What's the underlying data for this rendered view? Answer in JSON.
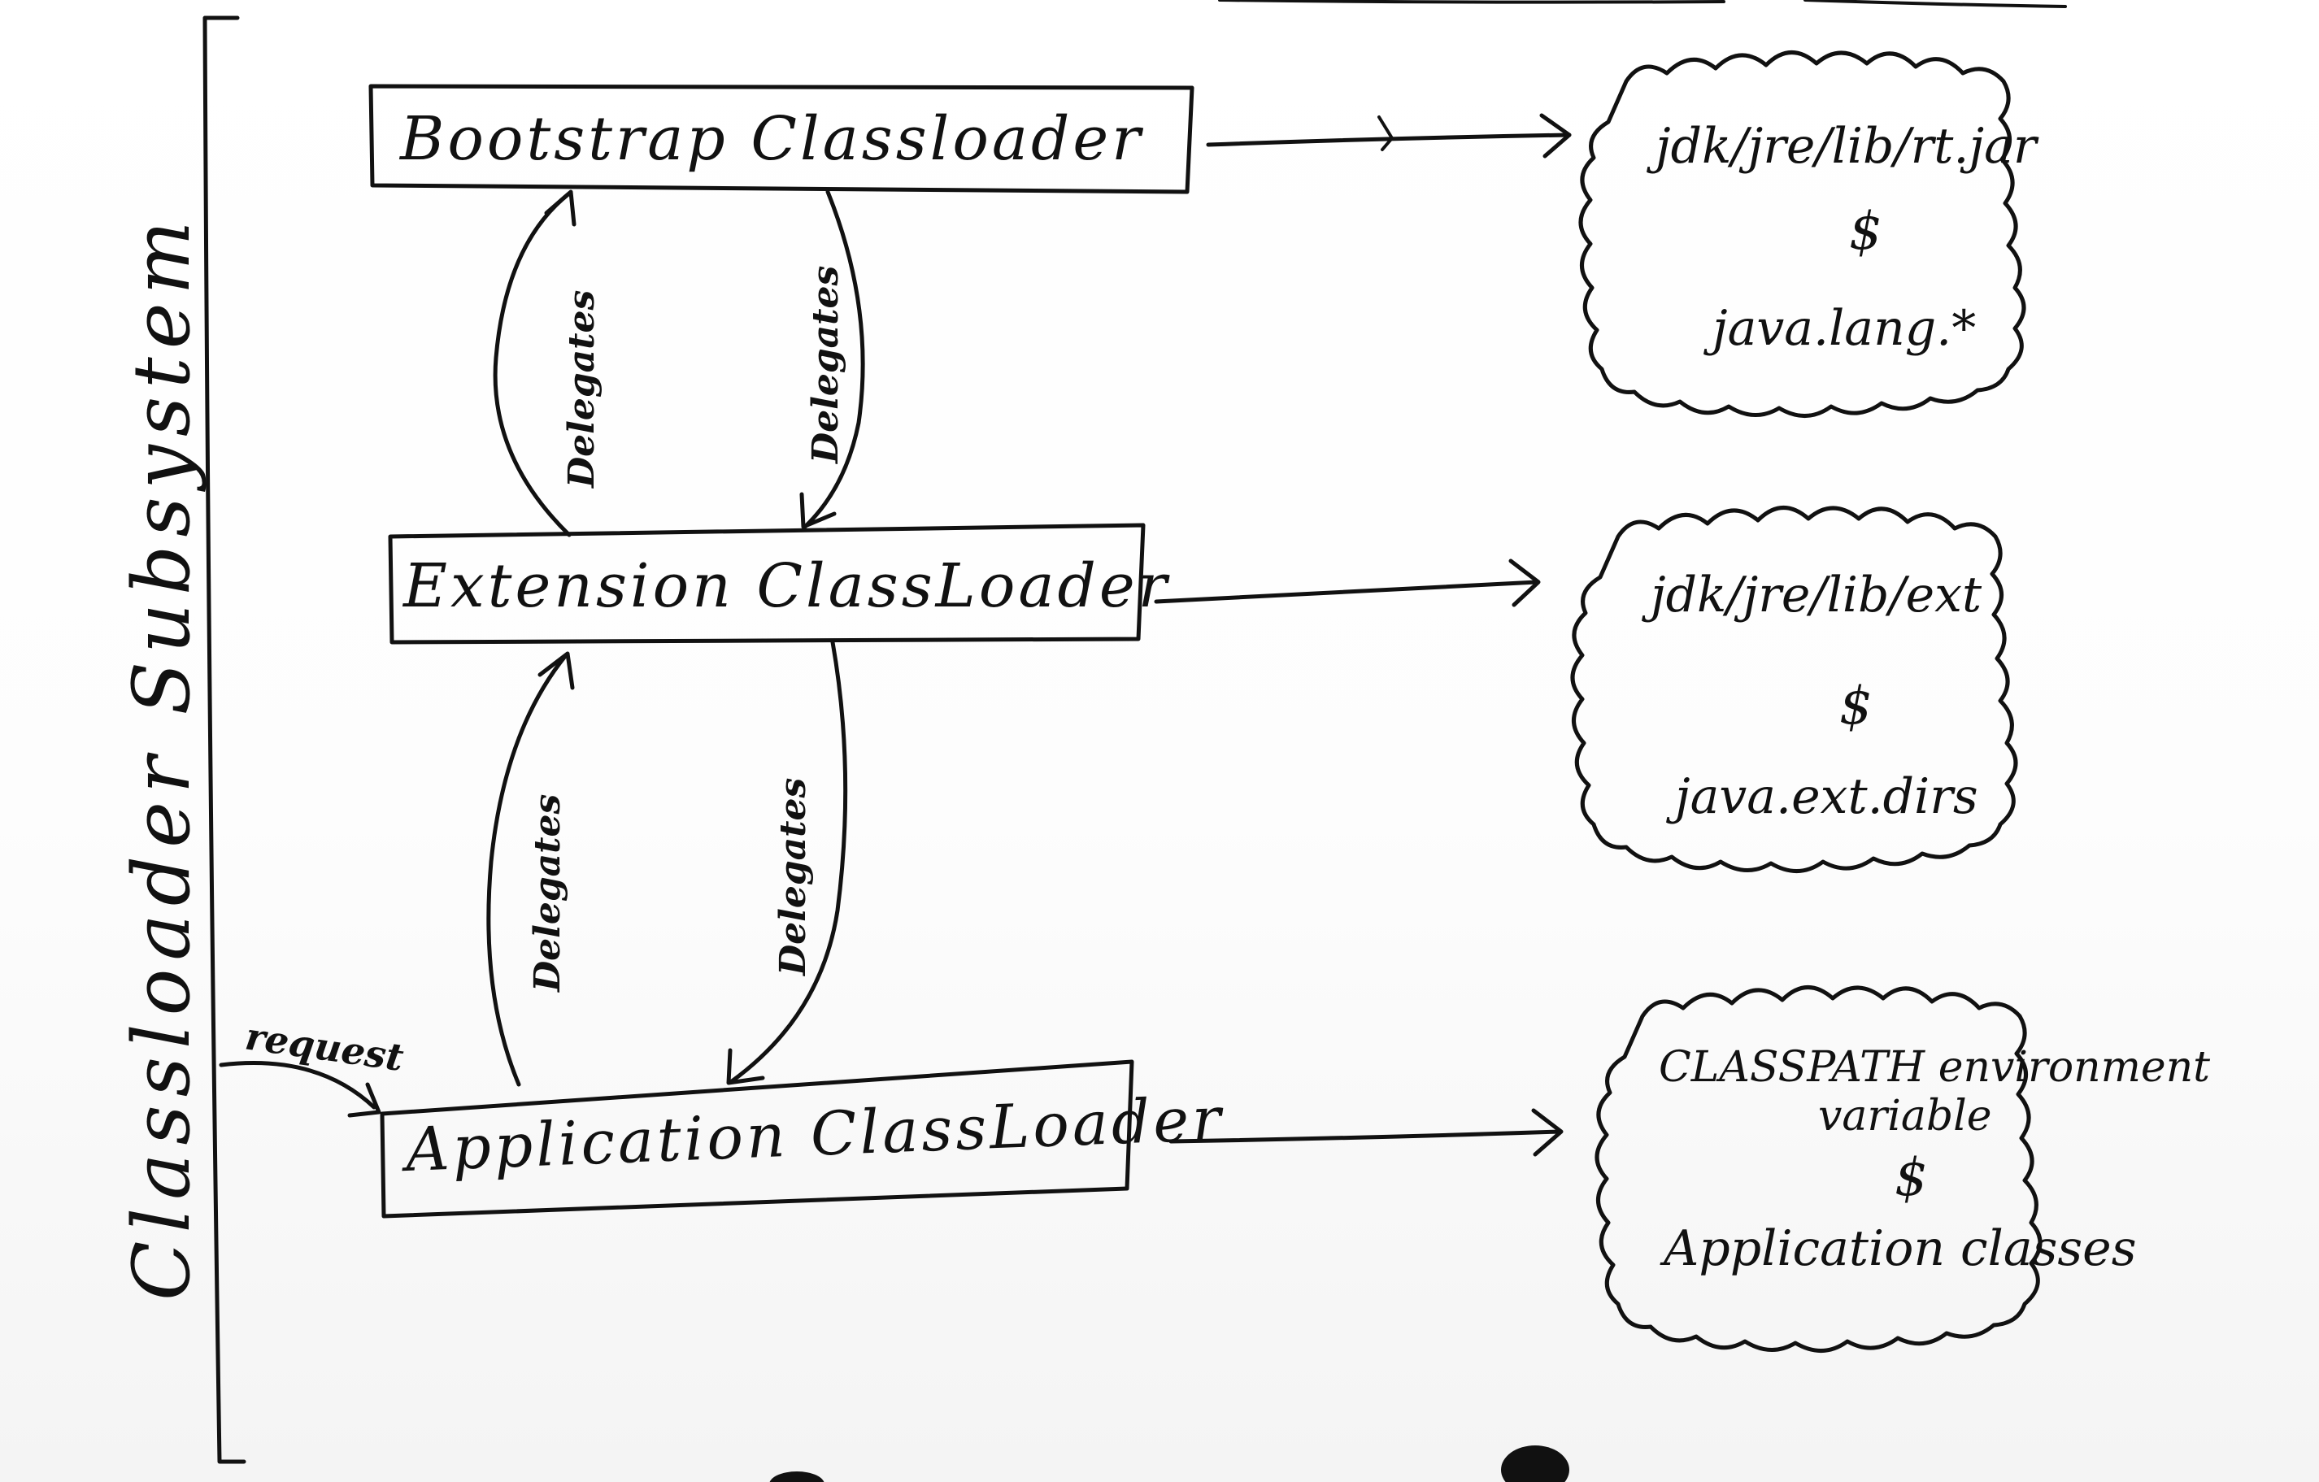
{
  "subsystem_label": "Classloader Subsystem",
  "request_label": "request",
  "loaders": [
    {
      "label": "Bootstrap Classloader"
    },
    {
      "label": "Extension ClassLoader"
    },
    {
      "label": "Application ClassLoader"
    }
  ],
  "delegation_labels": {
    "bootstrap_extension_up": "Delegates",
    "bootstrap_extension_down": "Delegates",
    "extension_application_up": "Delegates",
    "extension_application_down": "Delegates"
  },
  "sources": [
    {
      "line1": "jdk/jre/lib/rt.jar",
      "separator": "$",
      "line2": "java.lang.*"
    },
    {
      "line1": "jdk/jre/lib/ext",
      "separator": "$",
      "line2": "java.ext.dirs"
    },
    {
      "line1": "CLASSPATH environment",
      "line1b": "variable",
      "separator": "$",
      "line2": "Application classes"
    }
  ]
}
